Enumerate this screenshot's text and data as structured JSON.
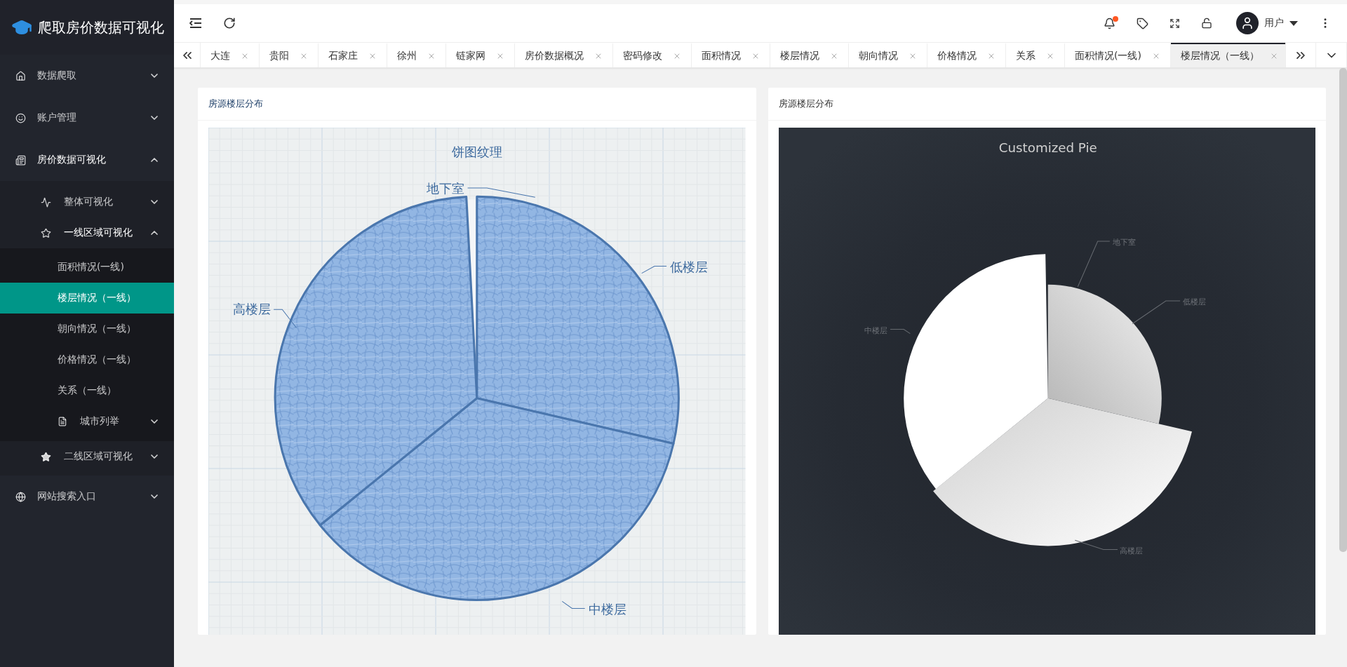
{
  "sidebar": {
    "title": "爬取房价数据可视化",
    "items": [
      {
        "label": "数据爬取",
        "expanded": false
      },
      {
        "label": "账户管理",
        "expanded": false
      },
      {
        "label": "房价数据可视化",
        "expanded": true,
        "children": [
          {
            "label": "整体可视化",
            "expanded": false
          },
          {
            "label": "一线区域可视化",
            "expanded": true,
            "children": [
              {
                "kind": "page",
                "label": "面积情况(一线)",
                "selected": false
              },
              {
                "kind": "page",
                "label": "楼层情况（一线）",
                "selected": true
              },
              {
                "kind": "page",
                "label": "朝向情况（一线）",
                "selected": false
              },
              {
                "kind": "page",
                "label": "价格情况（一线）",
                "selected": false
              },
              {
                "kind": "page",
                "label": "关系（一线）",
                "selected": false
              },
              {
                "kind": "group",
                "label": "城市列举",
                "expanded": false
              }
            ]
          },
          {
            "label": "二线区域可视化",
            "expanded": false
          }
        ]
      },
      {
        "label": "网站搜索入口",
        "expanded": false
      }
    ]
  },
  "header": {
    "notification_dot": true,
    "user": "用户"
  },
  "tabs": [
    {
      "label": "大连",
      "selected": false
    },
    {
      "label": "贵阳",
      "selected": false
    },
    {
      "label": "石家庄",
      "selected": false
    },
    {
      "label": "徐州",
      "selected": false
    },
    {
      "label": "链家网",
      "selected": false
    },
    {
      "label": "房价数据概况",
      "selected": false
    },
    {
      "label": "密码修改",
      "selected": false
    },
    {
      "label": "面积情况",
      "selected": false
    },
    {
      "label": "楼层情况",
      "selected": false
    },
    {
      "label": "朝向情况",
      "selected": false
    },
    {
      "label": "价格情况",
      "selected": false
    },
    {
      "label": "关系",
      "selected": false
    },
    {
      "label": "面积情况(一线)",
      "selected": false
    },
    {
      "label": "楼层情况（一线）",
      "selected": true
    }
  ],
  "cards": [
    {
      "kind": "textured",
      "title": "房源楼层分布",
      "chart_title": "饼图纹理",
      "slice_labels": [
        "地下室",
        "低楼层",
        "中楼层",
        "高楼层"
      ]
    },
    {
      "kind": "dark",
      "title": "房源楼层分布",
      "chart_title": "Customized Pie",
      "slice_labels": [
        "地下室",
        "低楼层",
        "中楼层",
        "高楼层"
      ]
    }
  ]
}
